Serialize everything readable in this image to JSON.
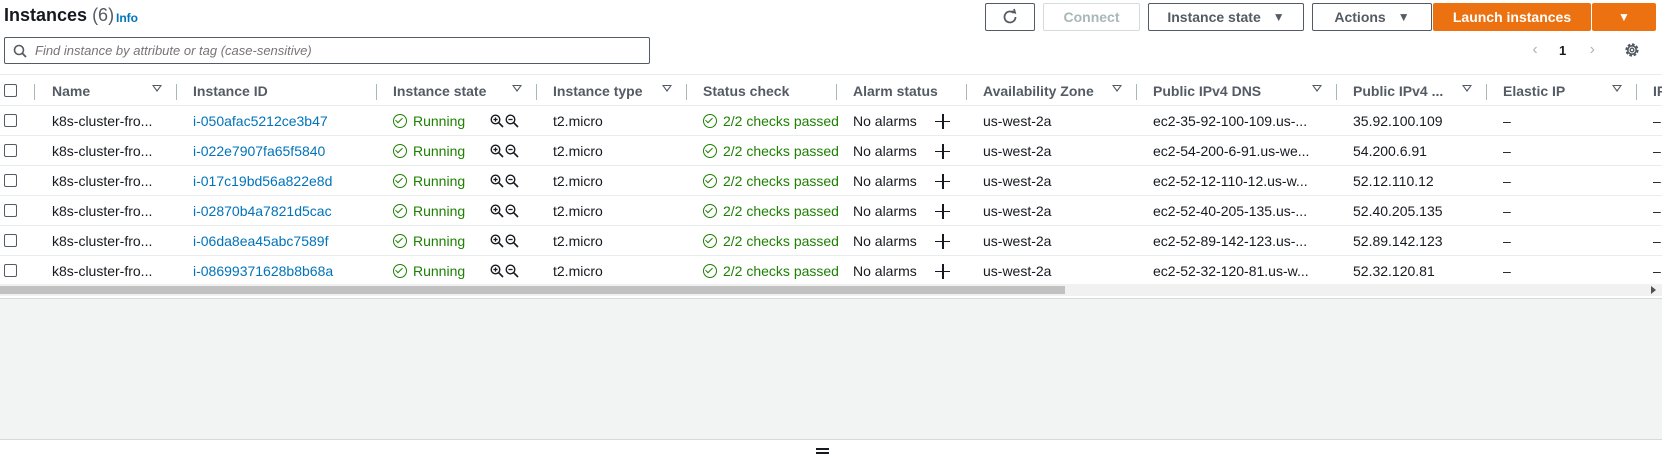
{
  "header": {
    "title": "Instances",
    "count": "(6)",
    "info": "Info",
    "connect_label": "Connect",
    "instance_state_label": "Instance state",
    "actions_label": "Actions",
    "launch_label": "Launch instances"
  },
  "search": {
    "placeholder": "Find instance by attribute or tag (case-sensitive)"
  },
  "pagination": {
    "current_page": "1"
  },
  "columns": {
    "name": "Name",
    "instance_id": "Instance ID",
    "instance_state": "Instance state",
    "instance_type": "Instance type",
    "status_check": "Status check",
    "alarm_status": "Alarm status",
    "availability_zone": "Availability Zone",
    "public_dns": "Public IPv4 DNS",
    "public_ip": "Public IPv4 ...",
    "elastic_ip": "Elastic IP",
    "truncated": "IP"
  },
  "rows": [
    {
      "name": "k8s-cluster-fro...",
      "id": "i-050afac5212ce3b47",
      "state": "Running",
      "type": "t2.micro",
      "status": "2/2 checks passed",
      "alarm": "No alarms",
      "az": "us-west-2a",
      "dns": "ec2-35-92-100-109.us-...",
      "ip": "35.92.100.109",
      "eip": "–",
      "extra": "–"
    },
    {
      "name": "k8s-cluster-fro...",
      "id": "i-022e7907fa65f5840",
      "state": "Running",
      "type": "t2.micro",
      "status": "2/2 checks passed",
      "alarm": "No alarms",
      "az": "us-west-2a",
      "dns": "ec2-54-200-6-91.us-we...",
      "ip": "54.200.6.91",
      "eip": "–",
      "extra": "–"
    },
    {
      "name": "k8s-cluster-fro...",
      "id": "i-017c19bd56a822e8d",
      "state": "Running",
      "type": "t2.micro",
      "status": "2/2 checks passed",
      "alarm": "No alarms",
      "az": "us-west-2a",
      "dns": "ec2-52-12-110-12.us-w...",
      "ip": "52.12.110.12",
      "eip": "–",
      "extra": "–"
    },
    {
      "name": "k8s-cluster-fro...",
      "id": "i-02870b4a7821d5cac",
      "state": "Running",
      "type": "t2.micro",
      "status": "2/2 checks passed",
      "alarm": "No alarms",
      "az": "us-west-2a",
      "dns": "ec2-52-40-205-135.us-...",
      "ip": "52.40.205.135",
      "eip": "–",
      "extra": "–"
    },
    {
      "name": "k8s-cluster-fro...",
      "id": "i-06da8ea45abc7589f",
      "state": "Running",
      "type": "t2.micro",
      "status": "2/2 checks passed",
      "alarm": "No alarms",
      "az": "us-west-2a",
      "dns": "ec2-52-89-142-123.us-...",
      "ip": "52.89.142.123",
      "eip": "–",
      "extra": "–"
    },
    {
      "name": "k8s-cluster-fro...",
      "id": "i-08699371628b8b68a",
      "state": "Running",
      "type": "t2.micro",
      "status": "2/2 checks passed",
      "alarm": "No alarms",
      "az": "us-west-2a",
      "dns": "ec2-52-32-120-81.us-w...",
      "ip": "52.32.120.81",
      "eip": "–",
      "extra": "–"
    }
  ],
  "colors": {
    "link": "#0073bb",
    "success": "#1d8102",
    "primary_button": "#ec7211"
  },
  "icons": [
    "refresh-icon",
    "caret-down-icon",
    "search-icon",
    "chevron-left-icon",
    "chevron-right-icon",
    "gear-icon",
    "sort-icon",
    "check-circle-icon",
    "zoom-in-icon",
    "zoom-out-icon",
    "plus-icon",
    "drag-handle-icon"
  ]
}
